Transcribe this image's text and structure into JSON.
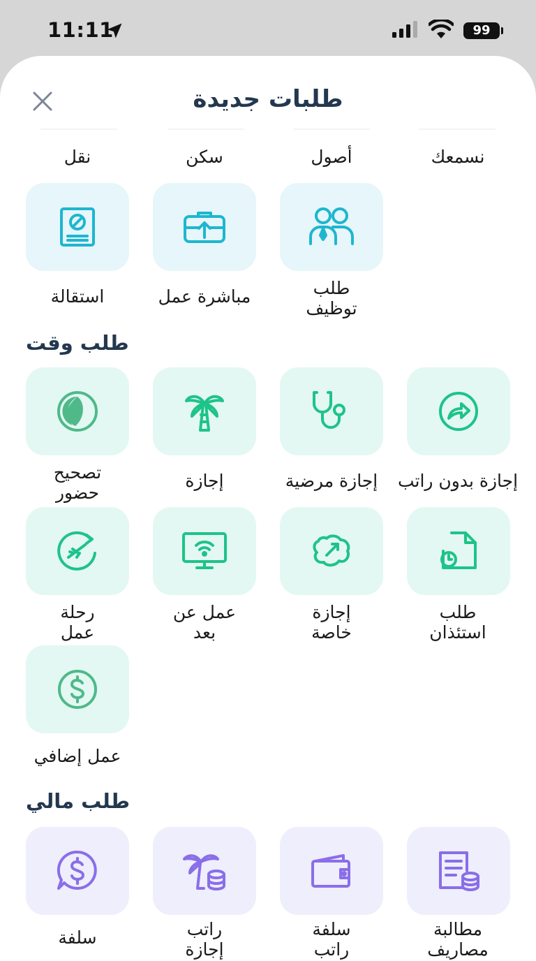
{
  "status": {
    "time": "11:11",
    "battery": "99"
  },
  "header": {
    "title": "طلبات جديدة"
  },
  "top_row": [
    "نسمعك",
    "أصول",
    "سكن",
    "نقل"
  ],
  "hr_row": [
    {
      "label": "طلب\nتوظيف",
      "icon": "users-icon"
    },
    {
      "label": "مباشرة عمل",
      "icon": "briefcase-upload-icon"
    },
    {
      "label": "استقالة",
      "icon": "resignation-document-icon"
    }
  ],
  "time_section": {
    "title": "طلب وقت",
    "items": [
      {
        "label": "إجازة بدون راتب",
        "icon": "forward-arrow-icon"
      },
      {
        "label": "إجازة مرضية",
        "icon": "stethoscope-icon"
      },
      {
        "label": "إجازة",
        "icon": "palm-tree-icon"
      },
      {
        "label": "تصحيح\nحضور",
        "icon": "half-circle-icon"
      },
      {
        "label": "طلب\nاستئذان",
        "icon": "document-clock-icon"
      },
      {
        "label": "إجازة\nخاصة",
        "icon": "special-leave-icon"
      },
      {
        "label": "عمل عن\nبعد",
        "icon": "monitor-wifi-icon"
      },
      {
        "label": "رحلة\nعمل",
        "icon": "airplane-icon"
      },
      {
        "label": "عمل إضافي",
        "icon": "dollar-circle-icon"
      }
    ]
  },
  "finance_section": {
    "title": "طلب مالي",
    "items": [
      {
        "label": "مطالبة\nمصاريف",
        "icon": "invoice-coins-icon"
      },
      {
        "label": "سلفة\nراتب",
        "icon": "wallet-icon"
      },
      {
        "label": "راتب\nإجازة",
        "icon": "palm-coins-icon"
      },
      {
        "label": "سلفة",
        "icon": "dollar-chat-icon"
      }
    ]
  },
  "colors": {
    "blue_icon": "#1eb6cf",
    "green_icon": "#1ec38a",
    "purple_icon": "#8a6ee8",
    "title": "#23384f"
  }
}
